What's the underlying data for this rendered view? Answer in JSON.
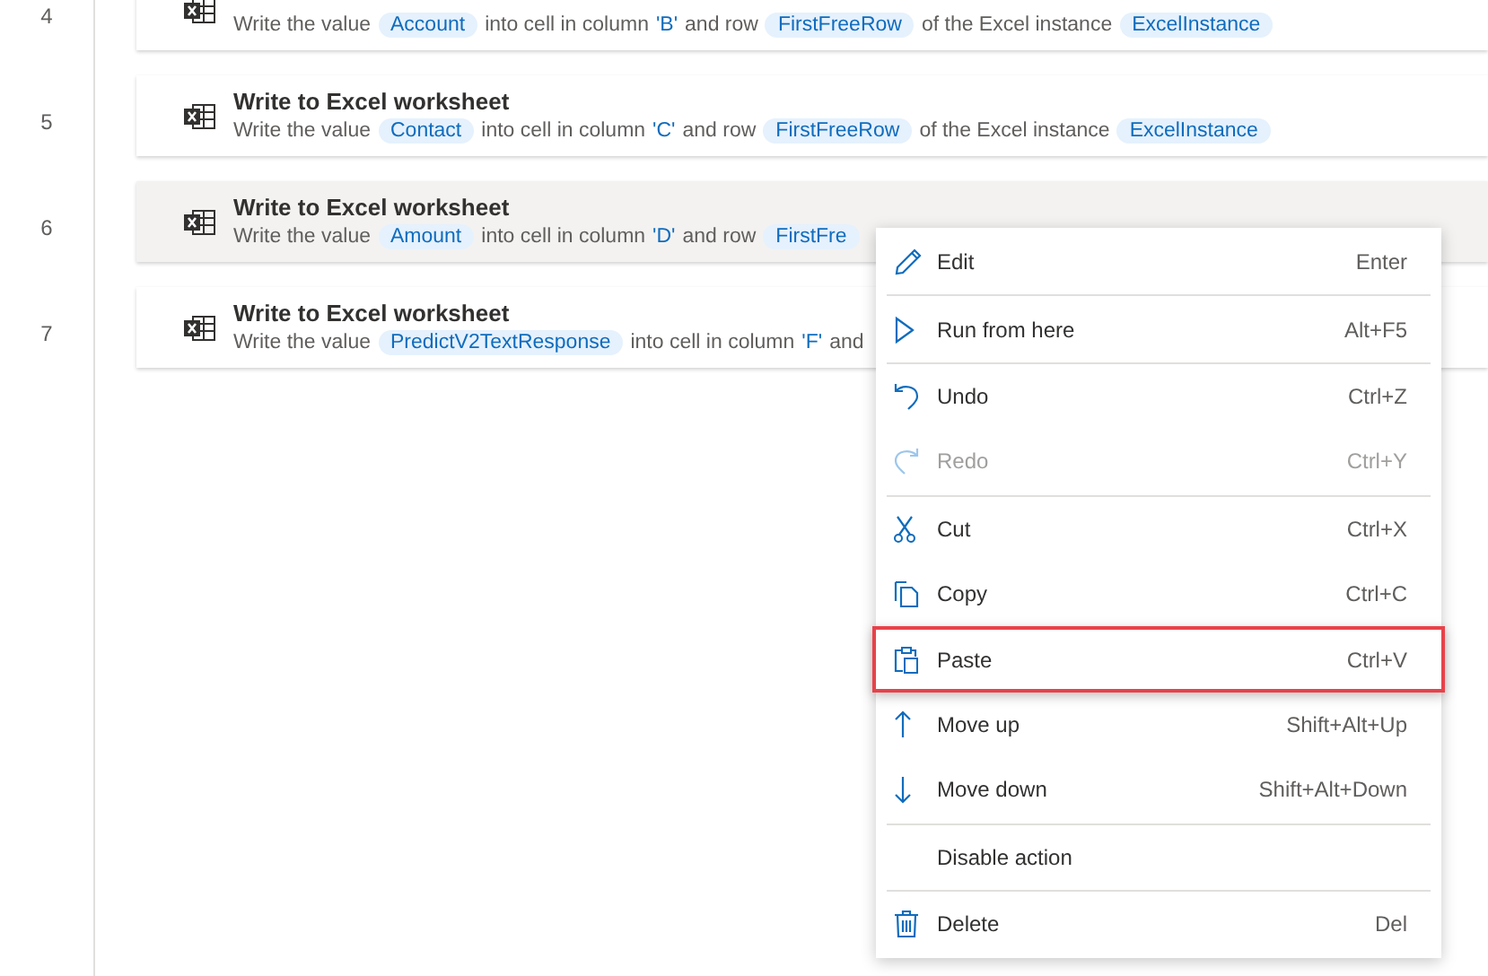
{
  "actions": [
    {
      "number": "4",
      "selected": false,
      "parts": [
        {
          "kind": "text",
          "text": "Write the value"
        },
        {
          "kind": "token",
          "text": "Account"
        },
        {
          "kind": "text",
          "text": "into cell in column"
        },
        {
          "kind": "literal",
          "text": "'B'"
        },
        {
          "kind": "text",
          "text": "and row"
        },
        {
          "kind": "token",
          "text": "FirstFreeRow"
        },
        {
          "kind": "text",
          "text": "of the Excel instance"
        },
        {
          "kind": "token",
          "text": "ExcelInstance"
        }
      ]
    },
    {
      "number": "5",
      "title": "Write to Excel worksheet",
      "selected": false,
      "parts": [
        {
          "kind": "text",
          "text": "Write the value"
        },
        {
          "kind": "token",
          "text": "Contact"
        },
        {
          "kind": "text",
          "text": "into cell in column"
        },
        {
          "kind": "literal",
          "text": "'C'"
        },
        {
          "kind": "text",
          "text": "and row"
        },
        {
          "kind": "token",
          "text": "FirstFreeRow"
        },
        {
          "kind": "text",
          "text": "of the Excel instance"
        },
        {
          "kind": "token",
          "text": "ExcelInstance"
        }
      ]
    },
    {
      "number": "6",
      "title": "Write to Excel worksheet",
      "selected": true,
      "parts": [
        {
          "kind": "text",
          "text": "Write the value"
        },
        {
          "kind": "token",
          "text": "Amount"
        },
        {
          "kind": "text",
          "text": "into cell in column"
        },
        {
          "kind": "literal",
          "text": "'D'"
        },
        {
          "kind": "text",
          "text": "and row"
        },
        {
          "kind": "token",
          "text": "FirstFre"
        }
      ]
    },
    {
      "number": "7",
      "title": "Write to Excel worksheet",
      "selected": false,
      "parts": [
        {
          "kind": "text",
          "text": "Write the value"
        },
        {
          "kind": "token",
          "text": "PredictV2TextResponse"
        },
        {
          "kind": "text",
          "text": "into cell in column"
        },
        {
          "kind": "literal",
          "text": "'F'"
        },
        {
          "kind": "text",
          "text": "and"
        }
      ]
    }
  ],
  "context_menu": {
    "groups": [
      [
        {
          "kind": "pencil",
          "label": "Edit",
          "shortcut": "Enter",
          "disabled": false,
          "selected": false
        }
      ],
      [
        {
          "kind": "play",
          "label": "Run from here",
          "shortcut": "Alt+F5",
          "disabled": false,
          "selected": false
        }
      ],
      [
        {
          "kind": "undo",
          "label": "Undo",
          "shortcut": "Ctrl+Z",
          "disabled": false,
          "selected": false
        },
        {
          "kind": "redo",
          "label": "Redo",
          "shortcut": "Ctrl+Y",
          "disabled": true,
          "selected": false
        }
      ],
      [
        {
          "kind": "scissors",
          "label": "Cut",
          "shortcut": "Ctrl+X",
          "disabled": false,
          "selected": false
        },
        {
          "kind": "copy",
          "label": "Copy",
          "shortcut": "Ctrl+C",
          "disabled": false,
          "selected": false
        },
        {
          "kind": "paste",
          "label": "Paste",
          "shortcut": "Ctrl+V",
          "disabled": false,
          "selected": true
        },
        {
          "kind": "up",
          "label": "Move up",
          "shortcut": "Shift+Alt+Up",
          "disabled": false,
          "selected": false
        },
        {
          "kind": "down",
          "label": "Move down",
          "shortcut": "Shift+Alt+Down",
          "disabled": false,
          "selected": false
        }
      ],
      [
        {
          "kind": "none",
          "label": "Disable action",
          "disabled": false,
          "selected": false
        }
      ],
      [
        {
          "kind": "trash",
          "label": "Delete",
          "shortcut": "Del",
          "disabled": false,
          "selected": false
        }
      ]
    ]
  }
}
